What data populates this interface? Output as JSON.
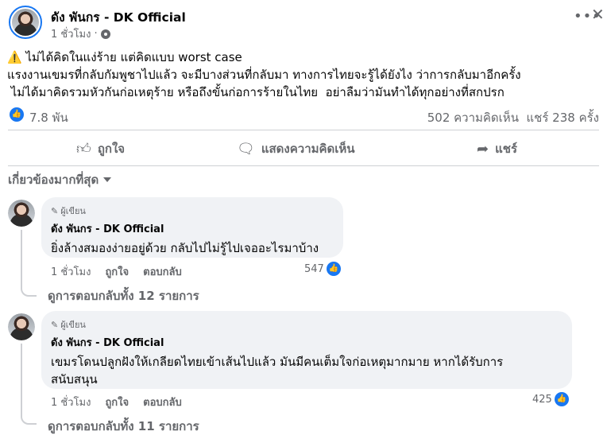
{
  "post": {
    "author": "ดัง พันกร - DK Official",
    "time": "1 ชั่วโมง",
    "separator": "·",
    "line1": "ไม่ได้คิดในแง่ร้าย แต่คิดแบบ worst case",
    "line2": "แรงงานเขมรที่กลับกัมพูชาไปแล้ว จะมีบางส่วนที่กลับมา ทางการไทยจะรู้ได้ยังไง ว่าการกลับมาอีกครั้ง",
    "line3": " ไม่ได้มาคิดรวมหัวกันก่อเหตุร้าย หรือถึงขั้นก่อการร้ายในไทย  อย่าลืมว่ามันทำได้ทุกอย่างที่สกปรก",
    "warning_icon": "⚠️",
    "likes": "7.8 พัน",
    "comments_count": "502 ความคิดเห็น",
    "shares_count": "แชร์ 238 ครั้ง"
  },
  "actions": {
    "like": "ถูกใจ",
    "comment": "แสดงความคิดเห็น",
    "share": "แชร์"
  },
  "sort_label": "เกี่ยวข้องมากที่สุด",
  "comments": [
    {
      "badge": "ผู้เขียน",
      "name": "ดัง พันกร - DK Official",
      "text": "ยิ่งล้างสมองง่ายอยู่ด้วย กลับไปไม่รู้ไปเจออะไรมาบ้าง",
      "time": "1 ชั่วโมง",
      "like": "ถูกใจ",
      "reply": "ตอบกลับ",
      "reactions": "547",
      "view_replies": "ดูการตอบกลับทั้ง 12 รายการ"
    },
    {
      "badge": "ผู้เขียน",
      "name": "ดัง พันกร - DK Official",
      "text_line1": "เขมรโดนปลูกฝังให้เกลียดไทยเข้าเส้นไปแล้ว มันมีคนเต็มใจก่อเหตุมากมาย หากได้รับการ",
      "text_line2": "สนับสนุน",
      "time": "1 ชั่วโมง",
      "like": "ถูกใจ",
      "reply": "ตอบกลับ",
      "reactions": "425",
      "view_replies": "ดูการตอบกลับทั้ง 11 รายการ"
    }
  ],
  "icons": {
    "more": "more-options-icon",
    "close": "close-icon",
    "privacy": "gear-icon",
    "like": "thumbs-up-icon",
    "comment": "comment-icon",
    "share": "share-icon"
  },
  "colors": {
    "accent": "#1877f2",
    "muted": "#65676b",
    "bubble": "#f0f2f5"
  }
}
